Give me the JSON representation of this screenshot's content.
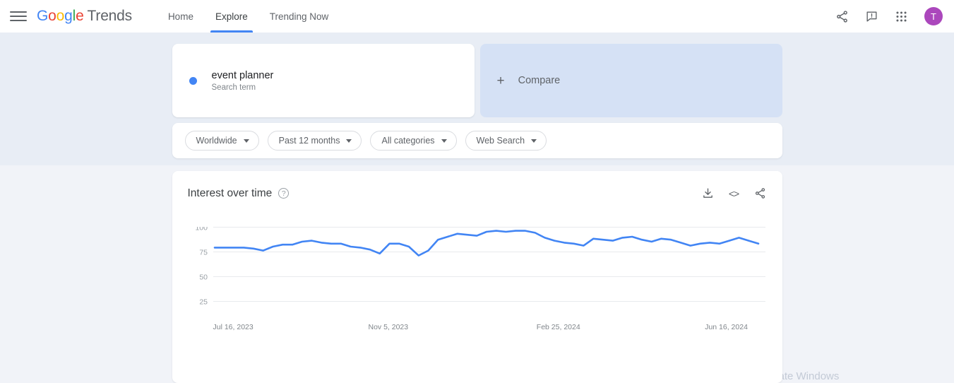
{
  "header": {
    "menu_icon": "hamburger-icon",
    "logo": {
      "g": "G",
      "o1": "o",
      "o2": "o",
      "g2": "g",
      "l": "l",
      "e": "e",
      "product": "Trends"
    },
    "nav": [
      {
        "label": "Home",
        "active": false
      },
      {
        "label": "Explore",
        "active": true
      },
      {
        "label": "Trending Now",
        "active": false
      }
    ],
    "icons": [
      "share-icon",
      "feedback-icon",
      "apps-grid-icon"
    ],
    "avatar_initial": "T",
    "avatar_color": "#ab47bc"
  },
  "terms": {
    "items": [
      {
        "name": "event planner",
        "subtitle": "Search term",
        "color": "#4285f4"
      }
    ],
    "compare": {
      "label": "Compare",
      "plus": "+"
    }
  },
  "filters": [
    {
      "label": "Worldwide"
    },
    {
      "label": "Past 12 months"
    },
    {
      "label": "All categories"
    },
    {
      "label": "Web Search"
    }
  ],
  "chart_card": {
    "title": "Interest over time",
    "help": "?",
    "actions": [
      {
        "name": "download-icon"
      },
      {
        "name": "embed-icon",
        "glyph": "<>"
      },
      {
        "name": "share-icon"
      }
    ]
  },
  "watermark": "Activate Windows",
  "chart_data": {
    "type": "line",
    "title": "Interest over time",
    "xlabel": "",
    "ylabel": "",
    "ylim": [
      0,
      100
    ],
    "yticks": [
      100,
      75,
      50,
      25
    ],
    "grid": true,
    "legend": false,
    "line_color": "#4285f4",
    "xtick_labels": [
      "Jul 16, 2023",
      "Nov 5, 2023",
      "Feb 25, 2024",
      "Jun 16, 2024"
    ],
    "xtick_positions": [
      0,
      0.2857,
      0.5952,
      0.9048
    ],
    "x": [
      "2023-07-16",
      "2023-07-23",
      "2023-07-30",
      "2023-08-06",
      "2023-08-13",
      "2023-08-20",
      "2023-08-27",
      "2023-09-03",
      "2023-09-10",
      "2023-09-17",
      "2023-09-24",
      "2023-10-01",
      "2023-10-08",
      "2023-10-15",
      "2023-10-22",
      "2023-10-29",
      "2023-11-05",
      "2023-11-12",
      "2023-11-19",
      "2023-11-26",
      "2023-12-03",
      "2023-12-10",
      "2023-12-17",
      "2023-12-24",
      "2023-12-31",
      "2024-01-07",
      "2024-01-14",
      "2024-01-21",
      "2024-01-28",
      "2024-02-04",
      "2024-02-11",
      "2024-02-18",
      "2024-02-25",
      "2024-03-03",
      "2024-03-10",
      "2024-03-17",
      "2024-03-24",
      "2024-03-31",
      "2024-04-07",
      "2024-04-14",
      "2024-04-21",
      "2024-04-28",
      "2024-05-05",
      "2024-05-12",
      "2024-05-19",
      "2024-05-26",
      "2024-06-02",
      "2024-06-09",
      "2024-06-16",
      "2024-06-23",
      "2024-06-30",
      "2024-07-07"
    ],
    "values": [
      79,
      79,
      79,
      79,
      78,
      76,
      80,
      82,
      82,
      85,
      86,
      84,
      83,
      83,
      80,
      79,
      77,
      73,
      83,
      83,
      80,
      71,
      76,
      87,
      90,
      93,
      92,
      91,
      95,
      96,
      95,
      96,
      96,
      94,
      89,
      86,
      84,
      83,
      81,
      88,
      87,
      86,
      89,
      90,
      87,
      85,
      88,
      87,
      84,
      81,
      83,
      84,
      83,
      86,
      89,
      86,
      83
    ]
  }
}
